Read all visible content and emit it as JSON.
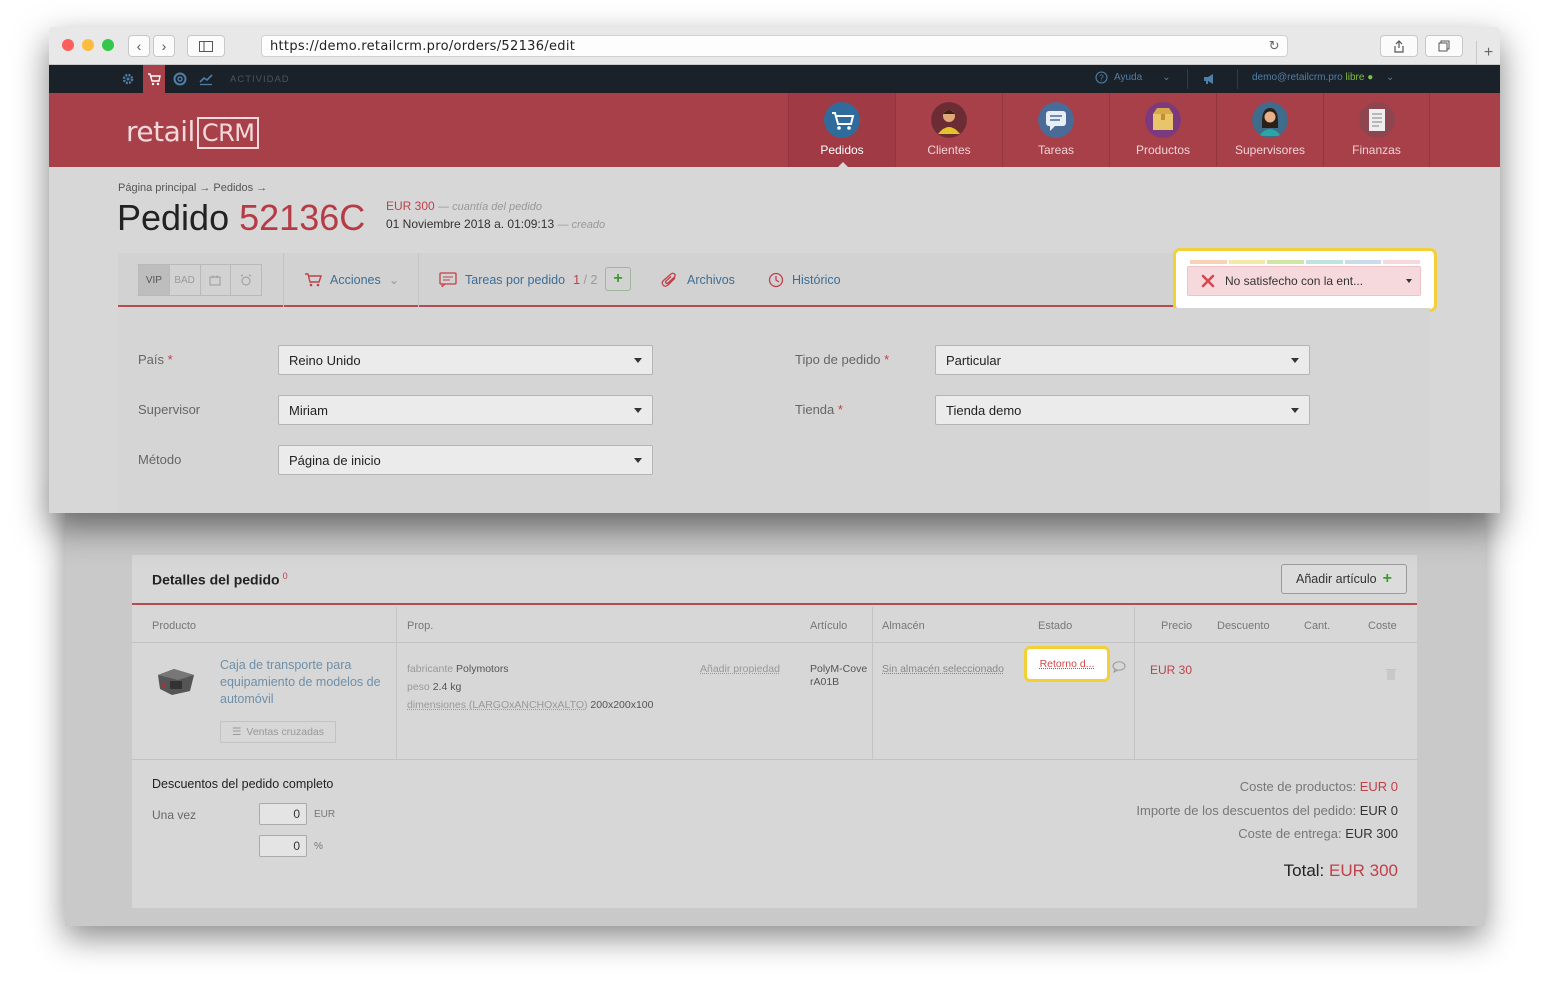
{
  "browser": {
    "url": "https://demo.retailcrm.pro/orders/52136/edit"
  },
  "topbar": {
    "activity_label": "ACTIVIDAD",
    "help_label": "Ayuda",
    "user_email": "demo@retailcrm.pro",
    "user_status": "libre"
  },
  "logo": {
    "part1": "retail",
    "part2": "CRM"
  },
  "nav": {
    "items": [
      {
        "label": "Pedidos",
        "icon": "cart-icon",
        "active": true
      },
      {
        "label": "Clientes",
        "icon": "customer-avatar-icon",
        "active": false
      },
      {
        "label": "Tareas",
        "icon": "tasks-chat-icon",
        "active": false
      },
      {
        "label": "Productos",
        "icon": "box-icon",
        "active": false
      },
      {
        "label": "Supervisores",
        "icon": "manager-avatar-icon",
        "active": false
      },
      {
        "label": "Finanzas",
        "icon": "finance-document-icon",
        "active": false
      }
    ]
  },
  "breadcrumb": "Página principal → Pedidos →",
  "order": {
    "title_prefix": "Pedido",
    "number": "52136C",
    "amount": "EUR 300",
    "amount_note": "— cuantía del pedido",
    "created_date": "01 Noviembre 2018 a. 01:09:13",
    "created_note": "— creado"
  },
  "toolbar": {
    "tags": [
      "VIP",
      "BAD"
    ],
    "actions_label": "Acciones",
    "tasks_label": "Tareas por pedido",
    "tasks_done": "1",
    "tasks_total": "/ 2",
    "files_label": "Archivos",
    "history_label": "Histórico"
  },
  "status": {
    "value": "No satisfecho con la ent...",
    "group_colors": [
      "#f6d2b6",
      "#f4eaa3",
      "#cfe6a4",
      "#bfe3dd",
      "#c9dcec",
      "#f6d9dc"
    ]
  },
  "form": {
    "pais_label": "País",
    "pais_value": "Reino Unido",
    "supervisor_label": "Supervisor",
    "supervisor_value": "Miriam",
    "metodo_label": "Método",
    "metodo_value": "Página de inicio",
    "tipo_label": "Tipo de pedido",
    "tipo_value": "Particular",
    "tienda_label": "Tienda",
    "tienda_value": "Tienda demo"
  },
  "details": {
    "title": "Detalles del pedido",
    "title_sup": "0",
    "add_item_label": "Añadir artículo",
    "columns": {
      "product": "Producto",
      "prop": "Prop.",
      "article": "Artículo",
      "warehouse": "Almacén",
      "status": "Estado",
      "price": "Precio",
      "discount": "Descuento",
      "qty": "Cant.",
      "cost": "Coste"
    },
    "row": {
      "name": "Caja de transporte para equipamiento de modelos de automóvil",
      "cross_sell_label": "Ventas cruzadas",
      "manufacturer_label": "fabricante",
      "manufacturer_value": "Polymotors",
      "weight_label": "peso",
      "weight_value": "2.4 kg",
      "dims_label": "dimensiones (LARGOxANCHOxALTO)",
      "dims_value": "200x200x100",
      "add_property_label": "Añadir propiedad",
      "article": "PolyM-CoverA01B",
      "warehouse": "Sin almacén seleccionado",
      "status": "Retorno d...",
      "price": "EUR 30"
    },
    "discounts": {
      "title": "Descuentos del pedido completo",
      "once_label": "Una vez",
      "amount_value": "0",
      "amount_unit": "EUR",
      "percent_value": "0",
      "percent_unit": "%"
    },
    "summary": {
      "products_cost_label": "Coste de productos:",
      "products_cost_value": "EUR 0",
      "discounts_label": "Importe de los descuentos del pedido:",
      "discounts_value": "EUR 0",
      "delivery_label": "Coste de entrega:",
      "delivery_value": "EUR 300",
      "total_label": "Total:",
      "total_value": "EUR 300"
    }
  }
}
